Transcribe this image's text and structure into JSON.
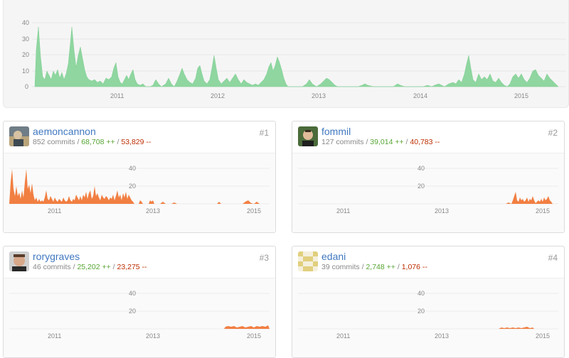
{
  "summary_chart": {
    "y_ticks": [
      "40",
      "30",
      "20",
      "10",
      "0"
    ],
    "x_ticks": [
      "2011",
      "2012",
      "2013",
      "2014",
      "2015"
    ],
    "color": "#6cc644",
    "fill": "#8fd6a0"
  },
  "contributors": [
    {
      "username": "aemoncannon",
      "commits": "852 commits",
      "additions": "68,708 ++",
      "deletions": "53,829 --",
      "rank": "#1",
      "x_ticks": [
        "2011",
        "2013",
        "2015"
      ],
      "y_ticks": [
        "40",
        "20"
      ]
    },
    {
      "username": "fommil",
      "commits": "127 commits",
      "additions": "39,014 ++",
      "deletions": "40,783 --",
      "rank": "#2",
      "x_ticks": [
        "2011",
        "2013",
        "2015"
      ],
      "y_ticks": [
        "40",
        "20"
      ]
    },
    {
      "username": "rorygraves",
      "commits": "46 commits",
      "additions": "25,202 ++",
      "deletions": "23,275 --",
      "rank": "#3",
      "x_ticks": [
        "2011",
        "2013",
        "2015"
      ],
      "y_ticks": [
        "40",
        "20"
      ]
    },
    {
      "username": "edani",
      "commits": "39 commits",
      "additions": "2,748 ++",
      "deletions": "1,076 --",
      "rank": "#4",
      "x_ticks": [
        "2011",
        "2013",
        "2015"
      ],
      "y_ticks": [
        "40",
        "20"
      ]
    }
  ],
  "colors": {
    "link": "#4078c0",
    "additions": "#55a532",
    "deletions": "#bd2c00",
    "contributor_area": "#f17f42"
  }
}
